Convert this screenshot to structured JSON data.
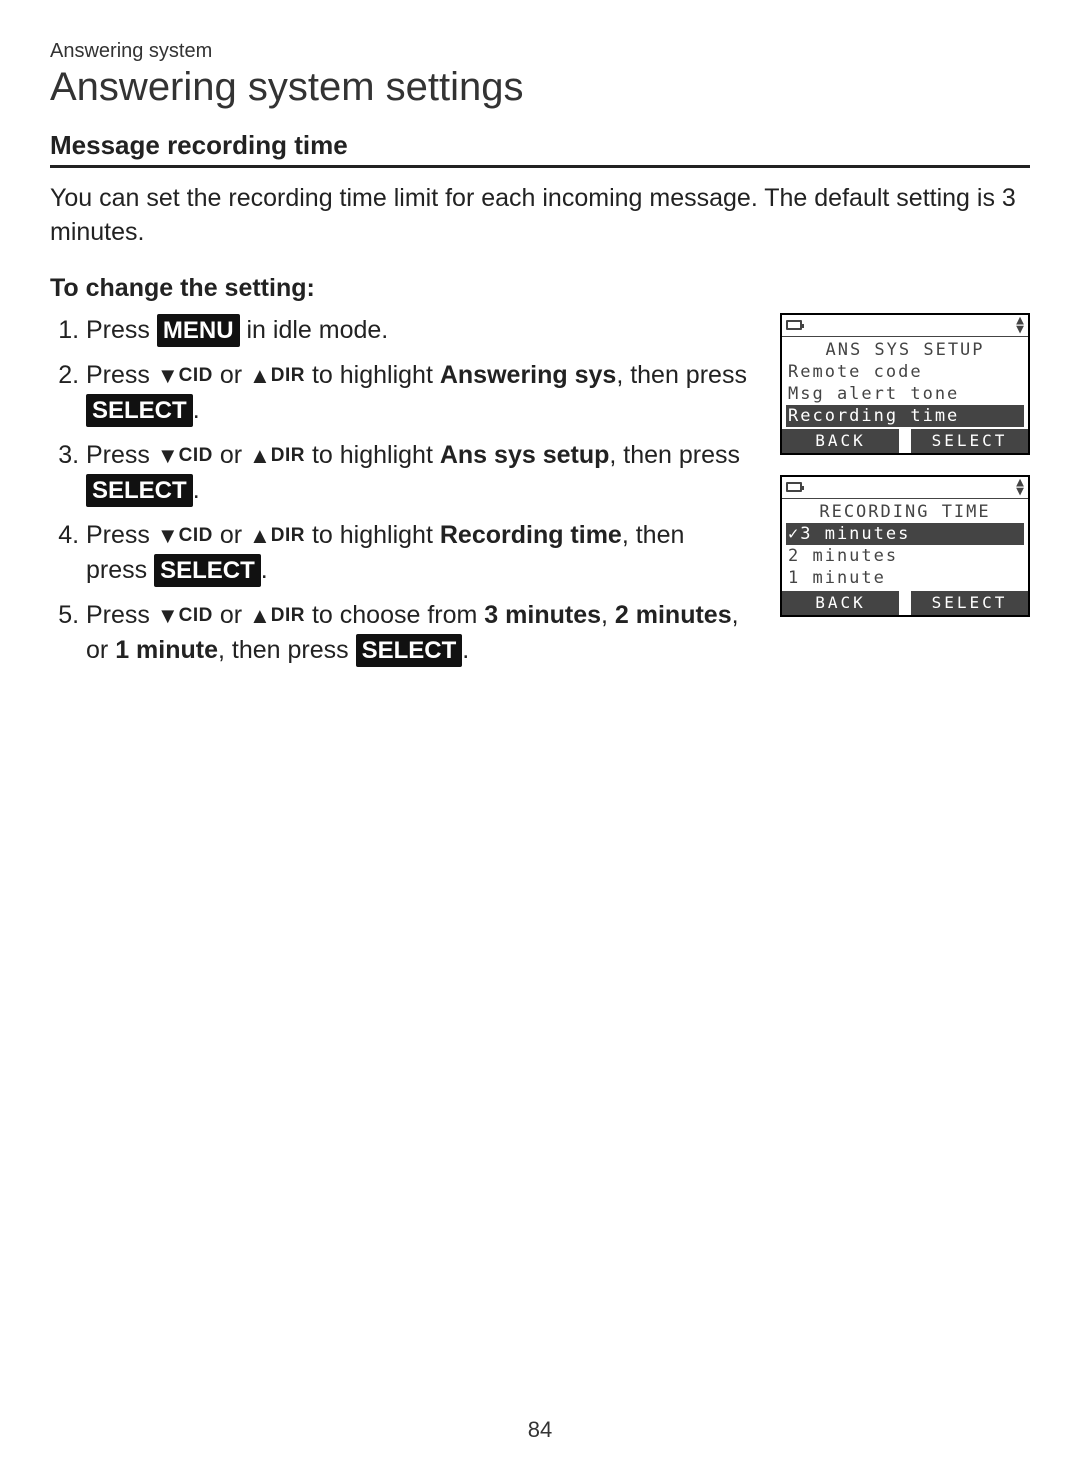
{
  "breadcrumb": "Answering system",
  "page_title": "Answering system settings",
  "section_heading": "Message recording time",
  "intro_text": "You can set the recording time limit for each incoming message. The default setting is 3 minutes.",
  "sub_heading": "To change the setting:",
  "buttons": {
    "menu": "MENU",
    "select": "SELECT"
  },
  "keys": {
    "down_glyph": "▼",
    "down_label": "CID",
    "up_glyph": "▲",
    "up_label": "DIR"
  },
  "steps": {
    "s1_a": "Press ",
    "s1_b": " in idle mode.",
    "s2_a": "Press ",
    "s2_mid": " or ",
    "s2_b": " to highlight ",
    "s2_target": "Answering sys",
    "s2_c": ", then press ",
    "s3_target": "Ans sys setup",
    "s4_target": "Recording time",
    "s5_b": " to choose from ",
    "s5_opt1": "3 minutes",
    "s5_sep": ", ",
    "s5_opt2": "2 minutes",
    "s5_or": ", or ",
    "s5_opt3": "1 minute",
    "s5_c": ", then press "
  },
  "lcd1": {
    "title": "ANS SYS SETUP",
    "row1": "Remote code",
    "row2": "Msg alert tone",
    "row3": "Recording time",
    "back": "BACK",
    "select": "SELECT"
  },
  "lcd2": {
    "title": "RECORDING TIME",
    "row1": "✓3 minutes",
    "row2": " 2 minutes",
    "row3": " 1 minute",
    "back": "BACK",
    "select": "SELECT"
  },
  "page_number": "84"
}
